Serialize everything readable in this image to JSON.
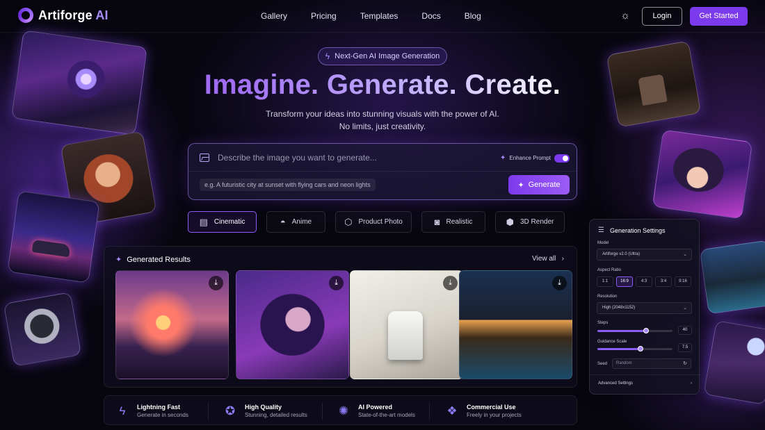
{
  "brand": {
    "name": "Artiforge",
    "suffix": "AI"
  },
  "nav": {
    "links": [
      "Gallery",
      "Pricing",
      "Templates",
      "Docs",
      "Blog"
    ],
    "login": "Login",
    "get_started": "Get Started",
    "theme_icon": "sun-icon"
  },
  "hero": {
    "badge": "Next-Gen AI Image Generation",
    "title": "Imagine. Generate. Create.",
    "subtitle_line1": "Transform your ideas into stunning visuals with the power of AI.",
    "subtitle_line2": "No limits, just creativity."
  },
  "prompt": {
    "placeholder": "Describe the image you want to generate...",
    "enhance_label": "Enhance Prompt",
    "enhance_on": true,
    "example": "e.g. A futuristic city at sunset with flying cars and neon lights",
    "generate": "Generate"
  },
  "styles": [
    {
      "label": "Cinematic",
      "icon": "clapperboard-icon",
      "active": true
    },
    {
      "label": "Anime",
      "icon": "mask-icon",
      "active": false
    },
    {
      "label": "Product Photo",
      "icon": "box-icon",
      "active": false
    },
    {
      "label": "Realistic",
      "icon": "camera-icon",
      "active": false
    },
    {
      "label": "3D Render",
      "icon": "cube-icon",
      "active": false
    }
  ],
  "results": {
    "title": "Generated Results",
    "view_all": "View all"
  },
  "features": [
    {
      "title": "Lightning Fast",
      "subtitle": "Generate in seconds",
      "icon": "bolt-icon"
    },
    {
      "title": "High Quality",
      "subtitle": "Stunning, detailed results",
      "icon": "quality-icon"
    },
    {
      "title": "AI Powered",
      "subtitle": "State-of-the-art models",
      "icon": "chip-icon"
    },
    {
      "title": "Commercial Use",
      "subtitle": "Freely in your projects",
      "icon": "license-icon"
    }
  ],
  "settings": {
    "title": "Generation Settings",
    "model_label": "Model",
    "model_value": "Artiforge v2.0 (Ultra)",
    "aspect_label": "Aspect Ratio",
    "aspect_options": [
      "1:1",
      "16:9",
      "4:3",
      "3:4",
      "9:16"
    ],
    "aspect_selected": "16:9",
    "resolution_label": "Resolution",
    "resolution_value": "High (2048x1152)",
    "steps_label": "Steps",
    "steps_value": "40",
    "steps_fraction": 0.65,
    "guidance_label": "Guidance Scale",
    "guidance_value": "7.5",
    "guidance_fraction": 0.57,
    "seed_label": "Seed",
    "seed_placeholder": "Random",
    "advanced": "Advanced Settings"
  },
  "colors": {
    "accent": "#7c3aed",
    "accent_light": "#a78bfa",
    "background": "#07060f"
  }
}
